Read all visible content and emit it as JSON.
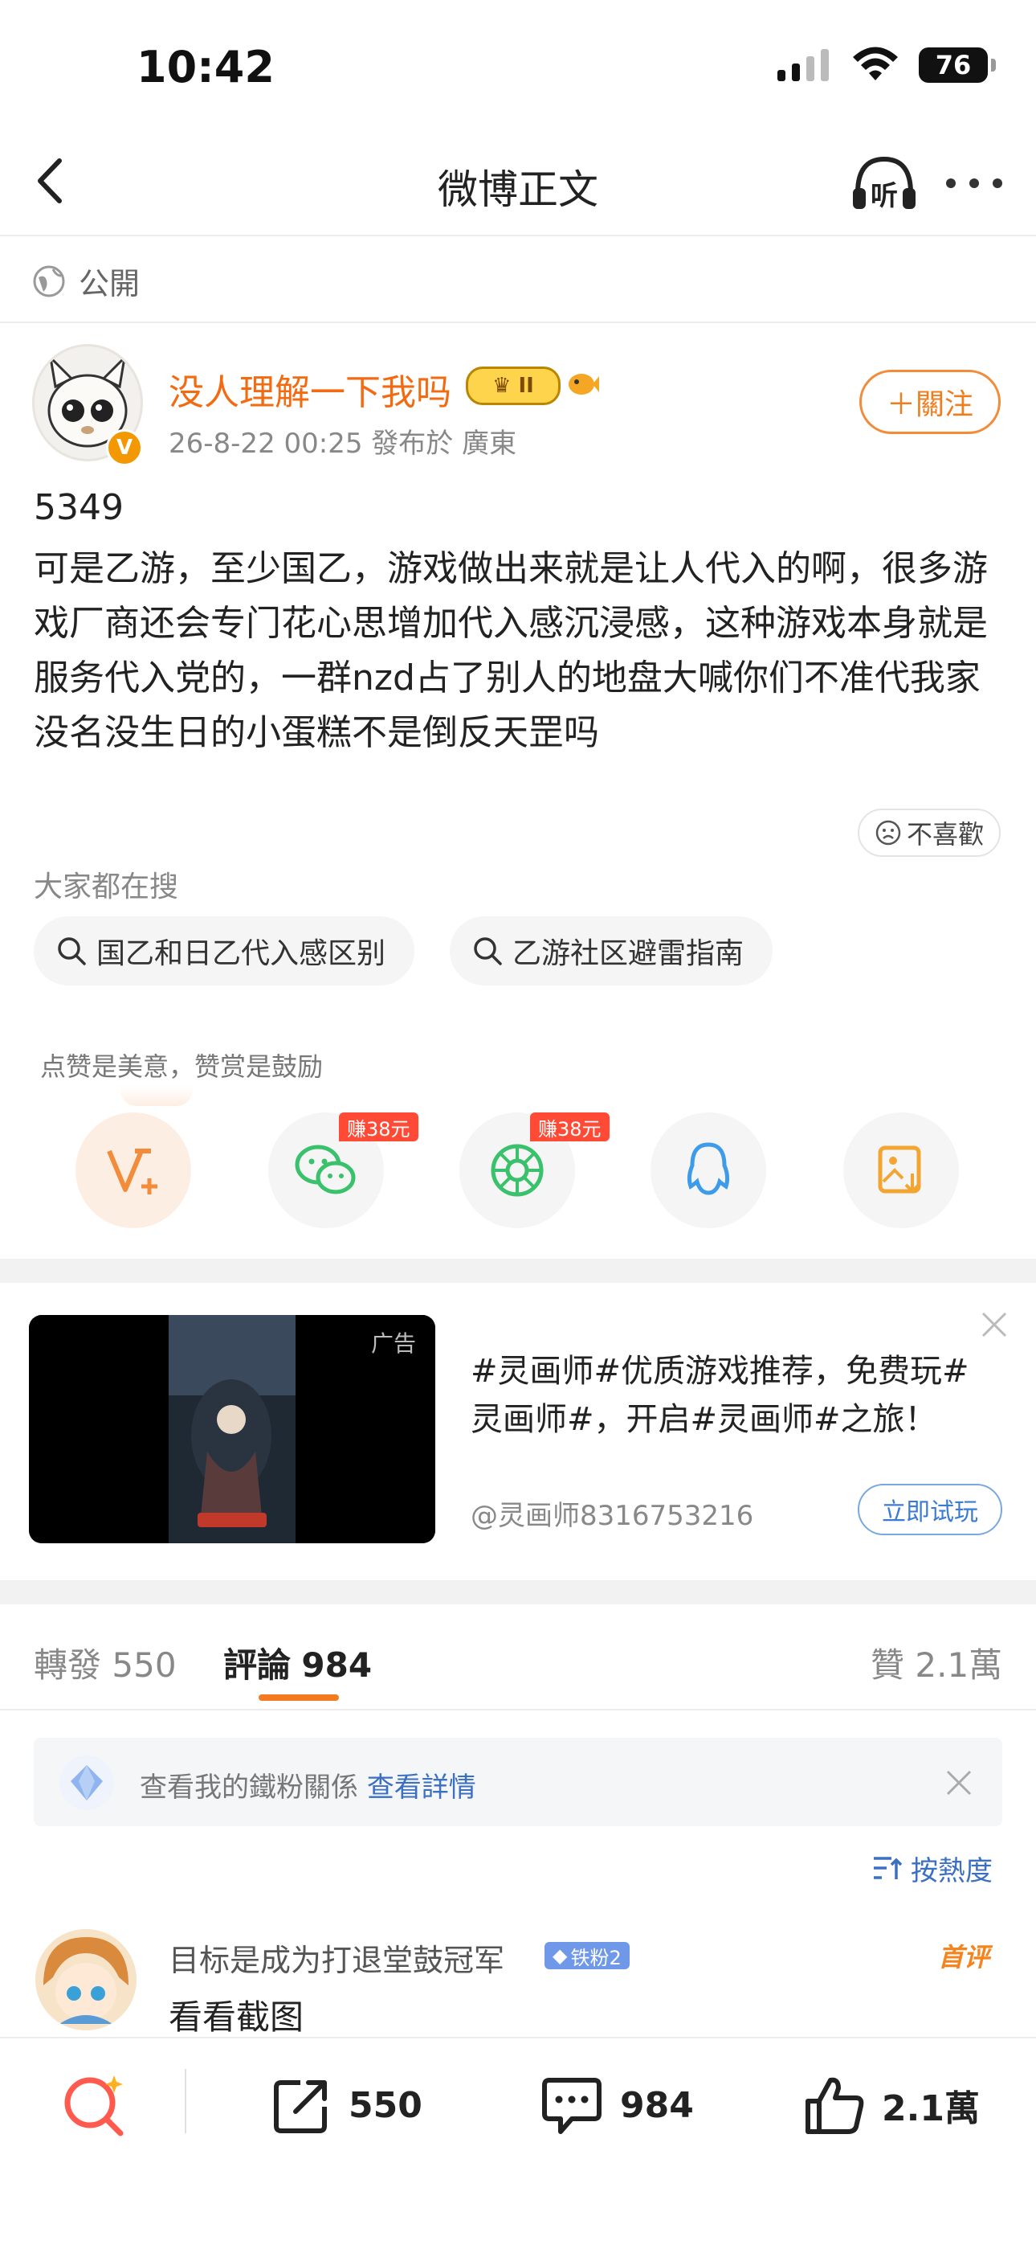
{
  "status_bar": {
    "time": "10:42",
    "battery": "76"
  },
  "nav": {
    "title": "微博正文",
    "listen_label": "听"
  },
  "post": {
    "visibility": "公開",
    "author": {
      "name": "没人理解一下我吗",
      "rank_badge": "II",
      "verified_mark": "V"
    },
    "meta": "26-8-22 00:25   發布於 廣東",
    "follow_label": "＋關注",
    "number": "5349",
    "body": "可是乙游，至少国乙，游戏做出来就是让人代入的啊，很多游戏厂商还会专门花心思增加代入感沉浸感，这种游戏本身就是服务代入党的，一群nzd占了别人的地盘大喊你们不准代我家没名没生日的小蛋糕不是倒反天罡吗",
    "dislike_label": "不喜歡"
  },
  "search": {
    "heading": "大家都在搜",
    "chips": [
      "国乙和日乙代入感区别",
      "乙游社区避雷指南"
    ]
  },
  "reward": {
    "tip": "点赞是美意，赞赏是鼓励",
    "earn_tags": [
      "赚38元",
      "赚38元"
    ]
  },
  "ad": {
    "tag": "广告",
    "text": "#灵画师#优质游戏推荐，免费玩#灵画师#，开启#灵画师#之旅！",
    "account": "@灵画师8316753216",
    "cta": "立即试玩"
  },
  "tabs": {
    "repost_label": "轉發",
    "repost_count": "550",
    "comment_label": "評論",
    "comment_count": "984",
    "like_label": "贊",
    "like_count": "2.1萬"
  },
  "fan_banner": {
    "text": "查看我的鐵粉關係",
    "link": "查看詳情"
  },
  "sort_label": "按熱度",
  "comment": {
    "user": "目标是成为打退堂鼓冠军",
    "fan_badge": "铁粉2",
    "first_tag": "首评",
    "text": "看看截图"
  },
  "bottom_bar": {
    "repost": "550",
    "comment": "984",
    "like": "2.1萬"
  },
  "colors": {
    "accent": "#f26b12",
    "link": "#3b6fc1",
    "ad_cta": "#3b7bd6"
  }
}
